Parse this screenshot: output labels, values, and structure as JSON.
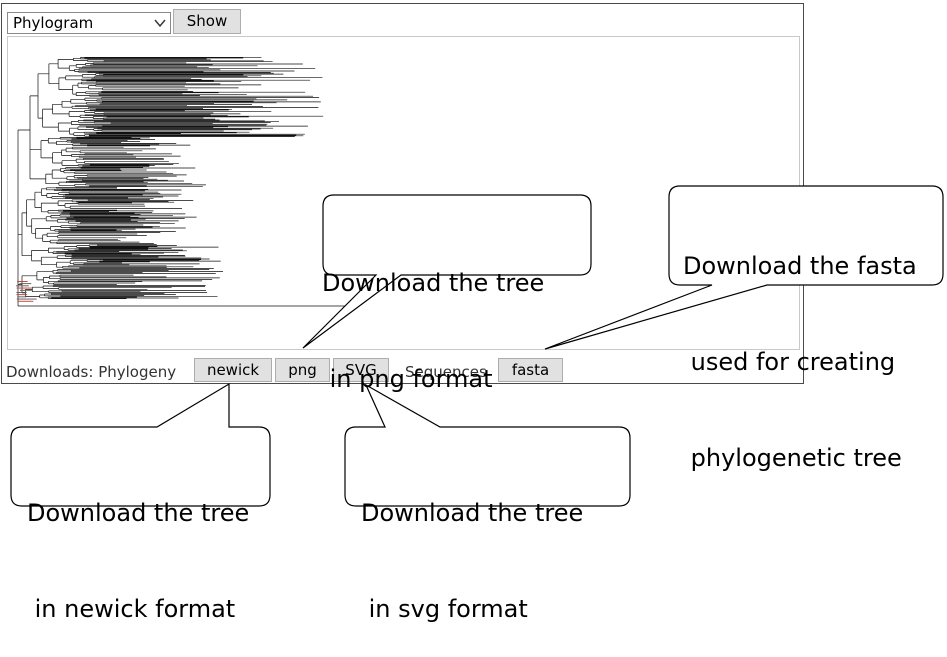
{
  "view_select": {
    "value": "Phylogram"
  },
  "show_button": {
    "label": "Show"
  },
  "downloads": {
    "label": "Downloads: Phylogeny",
    "newick": "newick",
    "png": "png",
    "svg": "SVG",
    "sequences_label": "Sequences",
    "fasta": "fasta"
  },
  "callouts": {
    "png": {
      "line1": "Download the tree",
      "line2": " in png format"
    },
    "fasta": {
      "line1": "Download the fasta",
      "line2": " used for creating",
      "line3": " phylogenetic tree"
    },
    "newick": {
      "line1": "Download the tree",
      "line2": " in newick format"
    },
    "svg": {
      "line1": "Download the tree",
      "line2": " in svg format"
    }
  }
}
